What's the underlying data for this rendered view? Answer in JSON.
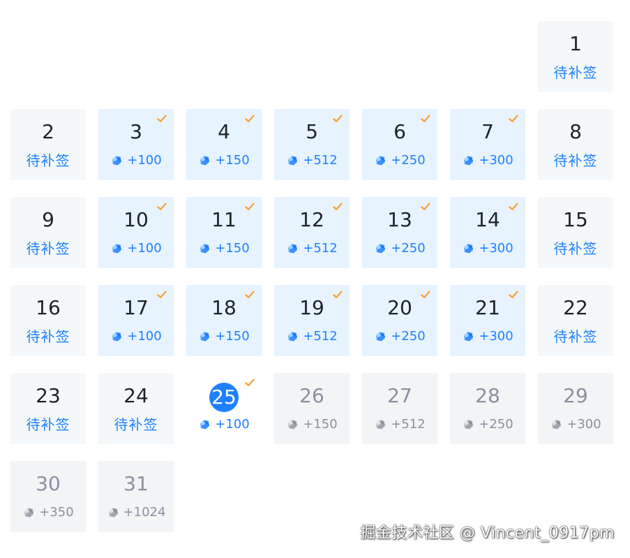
{
  "calendar": {
    "makeup_label": "待补签",
    "colors": {
      "accent": "#1e80ff",
      "check": "#ff9b2a",
      "signed_bg": "#e7f3ff",
      "pending_bg": "#f5f8fb",
      "future_bg": "#f2f4f6",
      "future_text": "#8a919f"
    },
    "icons": {
      "reward": "ore-icon",
      "signed": "check-icon"
    },
    "leading_blank_days": 6,
    "days": [
      {
        "day": "1",
        "state": "pending"
      },
      {
        "day": "2",
        "state": "pending"
      },
      {
        "day": "3",
        "state": "signed",
        "reward": "+100"
      },
      {
        "day": "4",
        "state": "signed",
        "reward": "+150"
      },
      {
        "day": "5",
        "state": "signed",
        "reward": "+512"
      },
      {
        "day": "6",
        "state": "signed",
        "reward": "+250"
      },
      {
        "day": "7",
        "state": "signed",
        "reward": "+300"
      },
      {
        "day": "8",
        "state": "pending"
      },
      {
        "day": "9",
        "state": "pending"
      },
      {
        "day": "10",
        "state": "signed",
        "reward": "+100"
      },
      {
        "day": "11",
        "state": "signed",
        "reward": "+150"
      },
      {
        "day": "12",
        "state": "signed",
        "reward": "+512"
      },
      {
        "day": "13",
        "state": "signed",
        "reward": "+250"
      },
      {
        "day": "14",
        "state": "signed",
        "reward": "+300"
      },
      {
        "day": "15",
        "state": "pending"
      },
      {
        "day": "16",
        "state": "pending"
      },
      {
        "day": "17",
        "state": "signed",
        "reward": "+100"
      },
      {
        "day": "18",
        "state": "signed",
        "reward": "+150"
      },
      {
        "day": "19",
        "state": "signed",
        "reward": "+512"
      },
      {
        "day": "20",
        "state": "signed",
        "reward": "+250"
      },
      {
        "day": "21",
        "state": "signed",
        "reward": "+300"
      },
      {
        "day": "22",
        "state": "pending"
      },
      {
        "day": "23",
        "state": "pending"
      },
      {
        "day": "24",
        "state": "pending"
      },
      {
        "day": "25",
        "state": "today",
        "reward": "+100"
      },
      {
        "day": "26",
        "state": "future",
        "reward": "+150"
      },
      {
        "day": "27",
        "state": "future",
        "reward": "+512"
      },
      {
        "day": "28",
        "state": "future",
        "reward": "+250"
      },
      {
        "day": "29",
        "state": "future",
        "reward": "+300"
      },
      {
        "day": "30",
        "state": "future",
        "reward": "+350"
      },
      {
        "day": "31",
        "state": "future",
        "reward": "+1024"
      }
    ]
  },
  "watermark": {
    "text": "掘金技术社区 @ Vincent_0917pm"
  }
}
